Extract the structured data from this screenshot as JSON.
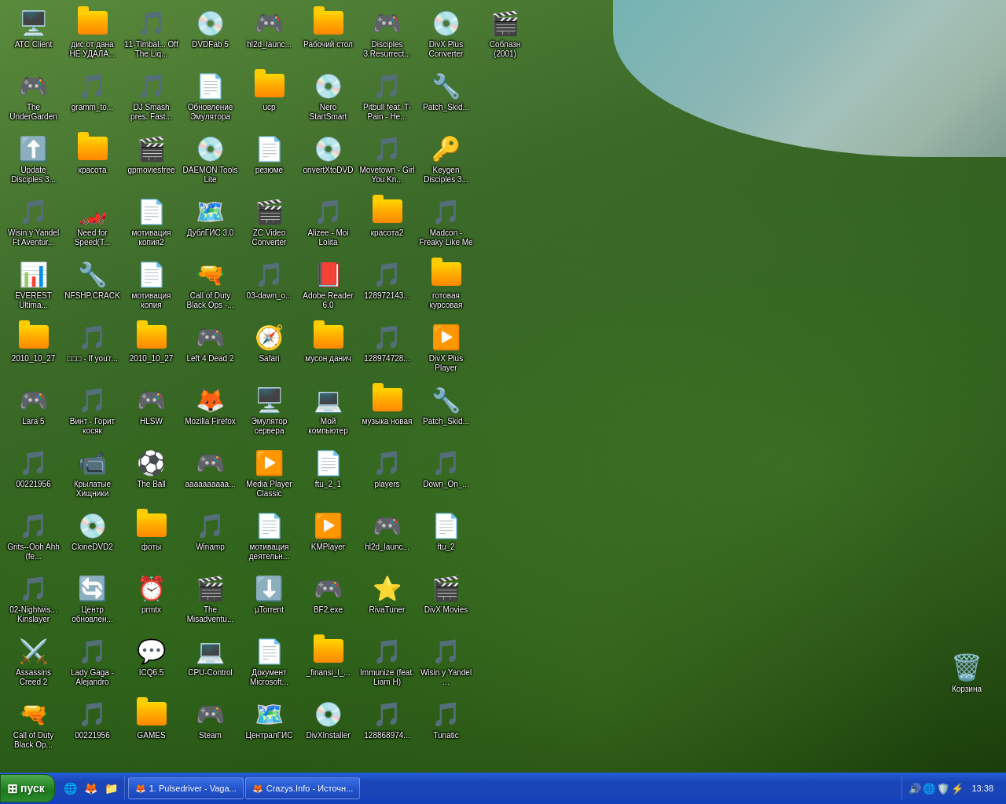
{
  "desktop": {
    "icons": [
      {
        "id": "atc-client",
        "label": "ATC Client",
        "type": "app",
        "emoji": "🖥️",
        "color": "blue"
      },
      {
        "id": "undergarden",
        "label": "The UnderGarden",
        "type": "game",
        "emoji": "🎮",
        "color": "green"
      },
      {
        "id": "update-disciples",
        "label": "Update Disciples 3...",
        "type": "app",
        "emoji": "⬆️",
        "color": "blue"
      },
      {
        "id": "wisin-yandel",
        "label": "Wisin y Yandel Ft Aventur...",
        "type": "media",
        "emoji": "🎵",
        "color": "orange"
      },
      {
        "id": "everest",
        "label": "EVEREST Ultima...",
        "type": "app",
        "emoji": "📊",
        "color": "blue"
      },
      {
        "id": "2010-10-27",
        "label": "2010_10_27",
        "type": "folder",
        "emoji": "📁",
        "color": "yellow"
      },
      {
        "id": "lara5",
        "label": "Lara 5",
        "type": "game",
        "emoji": "🎮",
        "color": "red"
      },
      {
        "id": "00221956-1",
        "label": "00221956",
        "type": "media",
        "emoji": "🎵",
        "color": "orange"
      },
      {
        "id": "grits",
        "label": "Grits--Ooh Ahh (fe...",
        "type": "media",
        "emoji": "🎵",
        "color": "orange"
      },
      {
        "id": "02-nightwis",
        "label": "02-Nightwis... Kinslayer",
        "type": "media",
        "emoji": "🎵",
        "color": "orange"
      },
      {
        "id": "assassins-creed",
        "label": "Assassins Creed 2",
        "type": "game",
        "emoji": "⚔️",
        "color": "white"
      },
      {
        "id": "call-of-duty",
        "label": "Call of Duty Black Op...",
        "type": "game",
        "emoji": "🔫",
        "color": "gray"
      },
      {
        "id": "disc-dana",
        "label": "дис от дана НЕ УДАЛА...",
        "type": "folder",
        "emoji": "📁",
        "color": "yellow"
      },
      {
        "id": "gramm-to",
        "label": "gramm_to...",
        "type": "media",
        "emoji": "🎵",
        "color": "orange"
      },
      {
        "id": "krasota",
        "label": "красота",
        "type": "folder",
        "emoji": "📁",
        "color": "yellow"
      },
      {
        "id": "need-speed",
        "label": "Need for Speed(T...",
        "type": "game",
        "emoji": "🏎️",
        "color": "red"
      },
      {
        "id": "nfshp-crack",
        "label": "NFSHP.CRACK",
        "type": "app",
        "emoji": "🔧",
        "color": "gray"
      },
      {
        "id": "box-ify",
        "label": "□□□ - If you&#39;r...",
        "type": "media",
        "emoji": "🎵",
        "color": "orange"
      },
      {
        "id": "vint",
        "label": "Винт - Горит косяк",
        "type": "media",
        "emoji": "🎵",
        "color": "orange"
      },
      {
        "id": "krylatye",
        "label": "Крылатые Хищники",
        "type": "media",
        "emoji": "📹",
        "color": "blue"
      },
      {
        "id": "clonedvd2",
        "label": "CloneDVD2",
        "type": "app",
        "emoji": "💿",
        "color": "red"
      },
      {
        "id": "centr",
        "label": "Центр обновлен...",
        "type": "app",
        "emoji": "🔄",
        "color": "blue"
      },
      {
        "id": "lady-gaga",
        "label": "Lady Gaga - Alejandro",
        "type": "media",
        "emoji": "🎵",
        "color": "orange"
      },
      {
        "id": "00221956-2",
        "label": "00221956",
        "type": "media",
        "emoji": "🎵",
        "color": "orange"
      },
      {
        "id": "11-timbal",
        "label": "11-Timbal... Off The Liq...",
        "type": "media",
        "emoji": "🎵",
        "color": "orange"
      },
      {
        "id": "dj-smash",
        "label": "DJ Smash pres. Fast...",
        "type": "media",
        "emoji": "🎵",
        "color": "orange"
      },
      {
        "id": "gpmoviesfree",
        "label": "gpmoviesfree",
        "type": "media",
        "emoji": "🎬",
        "color": "blue"
      },
      {
        "id": "motivaciya2",
        "label": "мотивация копия2",
        "type": "doc",
        "emoji": "📄",
        "color": "blue"
      },
      {
        "id": "motivaciya",
        "label": "мотивация копия",
        "type": "doc",
        "emoji": "📄",
        "color": "blue"
      },
      {
        "id": "2010-10-27b",
        "label": "2010_10_27",
        "type": "folder",
        "emoji": "📁",
        "color": "yellow"
      },
      {
        "id": "hlsw",
        "label": "HLSW",
        "type": "app",
        "emoji": "🎮",
        "color": "green"
      },
      {
        "id": "the-ball",
        "label": "The Ball",
        "type": "game",
        "emoji": "⚽",
        "color": "gray"
      },
      {
        "id": "foty",
        "label": "фоты",
        "type": "folder",
        "emoji": "📁",
        "color": "yellow"
      },
      {
        "id": "prmtx",
        "label": "prmtx",
        "type": "app",
        "emoji": "⏰",
        "color": "gray"
      },
      {
        "id": "icq65",
        "label": "ICQ6.5",
        "type": "app",
        "emoji": "💬",
        "color": "green"
      },
      {
        "id": "games",
        "label": "GAMES",
        "type": "folder",
        "emoji": "📁",
        "color": "yellow"
      },
      {
        "id": "dvdfab5",
        "label": "DVDFab 5",
        "type": "app",
        "emoji": "💿",
        "color": "purple"
      },
      {
        "id": "obnovlenie",
        "label": "Обновление Эмулятора",
        "type": "doc",
        "emoji": "📄",
        "color": "blue"
      },
      {
        "id": "daemon-tools",
        "label": "DAEMON Tools Lite",
        "type": "app",
        "emoji": "💿",
        "color": "red"
      },
      {
        "id": "dubgis",
        "label": "ДублГИС 3.0",
        "type": "app",
        "emoji": "🗺️",
        "color": "green"
      },
      {
        "id": "call-duty-ops",
        "label": "Call of Duty Black Ops -...",
        "type": "game",
        "emoji": "🔫",
        "color": "gray"
      },
      {
        "id": "left4dead",
        "label": "Left 4 Dead 2",
        "type": "game",
        "emoji": "🎮",
        "color": "red"
      },
      {
        "id": "firefox",
        "label": "Mozilla Firefox",
        "type": "app",
        "emoji": "🦊",
        "color": "orange"
      },
      {
        "id": "aaaa",
        "label": "аааааааааа...",
        "type": "app",
        "emoji": "🎮",
        "color": "red"
      },
      {
        "id": "winamp",
        "label": "Winamp",
        "type": "app",
        "emoji": "🎵",
        "color": "orange"
      },
      {
        "id": "misadventu",
        "label": "The Misadventu...",
        "type": "media",
        "emoji": "🎬",
        "color": "blue"
      },
      {
        "id": "cpu-control",
        "label": "CPU-Control",
        "type": "app",
        "emoji": "💻",
        "color": "green"
      },
      {
        "id": "steam",
        "label": "Steam",
        "type": "app",
        "emoji": "🎮",
        "color": "blue"
      },
      {
        "id": "hl2d-launc",
        "label": "hl2d_launc...",
        "type": "app",
        "emoji": "🎮",
        "color": "orange"
      },
      {
        "id": "ucp",
        "label": "ucp",
        "type": "folder",
        "emoji": "📁",
        "color": "yellow"
      },
      {
        "id": "rezyume",
        "label": "резюме",
        "type": "doc",
        "emoji": "📄",
        "color": "blue"
      },
      {
        "id": "zc-video",
        "label": "ZC Video Converter",
        "type": "app",
        "emoji": "🎬",
        "color": "blue"
      },
      {
        "id": "03-dawn",
        "label": "03-dawn_o...",
        "type": "media",
        "emoji": "🎵",
        "color": "orange"
      },
      {
        "id": "safari",
        "label": "Safari",
        "type": "app",
        "emoji": "🧭",
        "color": "blue"
      },
      {
        "id": "emulator-serv",
        "label": "Эмулятор сервера",
        "type": "app",
        "emoji": "🖥️",
        "color": "blue"
      },
      {
        "id": "media-player",
        "label": "Media Player Classic",
        "type": "app",
        "emoji": "▶️",
        "color": "gray"
      },
      {
        "id": "motivaciya-deyat",
        "label": "мотивация деятельн...",
        "type": "doc",
        "emoji": "📄",
        "color": "blue"
      },
      {
        "id": "utorrent",
        "label": "µTorrent",
        "type": "app",
        "emoji": "⬇️",
        "color": "green"
      },
      {
        "id": "doc-microsoft",
        "label": "Документ Microsoft...",
        "type": "doc",
        "emoji": "📄",
        "color": "blue"
      },
      {
        "id": "centralgis",
        "label": "ЦентралГИС",
        "type": "app",
        "emoji": "🗺️",
        "color": "green"
      },
      {
        "id": "rabochiy-stol",
        "label": "Рабочий стол",
        "type": "folder",
        "emoji": "📁",
        "color": "yellow"
      },
      {
        "id": "nero",
        "label": "Nero StartSmart",
        "type": "app",
        "emoji": "💿",
        "color": "red"
      },
      {
        "id": "convertdvd",
        "label": "onvertXtoDVD",
        "type": "app",
        "emoji": "💿",
        "color": "red"
      },
      {
        "id": "alizee",
        "label": "Alizee - Moi Lolita",
        "type": "media",
        "emoji": "🎵",
        "color": "orange"
      },
      {
        "id": "adobe-reader",
        "label": "Adobe Reader 6.0",
        "type": "app",
        "emoji": "📕",
        "color": "red"
      },
      {
        "id": "muzon",
        "label": "мусон данич",
        "type": "folder",
        "emoji": "📁",
        "color": "yellow"
      },
      {
        "id": "moy-comp",
        "label": "Мой компьютер",
        "type": "app",
        "emoji": "💻",
        "color": "gray"
      },
      {
        "id": "ftu2-1",
        "label": "ftu_2_1",
        "type": "doc",
        "emoji": "📄",
        "color": "blue"
      },
      {
        "id": "kmplayer",
        "label": "KMPlayer",
        "type": "app",
        "emoji": "▶️",
        "color": "blue"
      },
      {
        "id": "bf2exe",
        "label": "BF2.exe",
        "type": "game",
        "emoji": "🎮",
        "color": "gray"
      },
      {
        "id": "finansi",
        "label": "_finansi_l_...",
        "type": "folder",
        "emoji": "📁",
        "color": "yellow"
      },
      {
        "id": "divxinstaller",
        "label": "DivXInstaller",
        "type": "app",
        "emoji": "💿",
        "color": "blue"
      },
      {
        "id": "disciples3",
        "label": "Disciples 3.Resurrect...",
        "type": "game",
        "emoji": "🎮",
        "color": "red"
      },
      {
        "id": "pitbull",
        "label": "Pitbull feat. T-Pain - He...",
        "type": "media",
        "emoji": "🎵",
        "color": "orange"
      },
      {
        "id": "movetown",
        "label": "Movetown - Girl You Kn...",
        "type": "media",
        "emoji": "🎵",
        "color": "orange"
      },
      {
        "id": "krasota2",
        "label": "красота2",
        "type": "folder",
        "emoji": "📁",
        "color": "yellow"
      },
      {
        "id": "128972143",
        "label": "128972143...",
        "type": "media",
        "emoji": "🎵",
        "color": "orange"
      },
      {
        "id": "128974728",
        "label": "128974728...",
        "type": "media",
        "emoji": "🎵",
        "color": "orange"
      },
      {
        "id": "muzika-nova",
        "label": "музыка новая",
        "type": "folder",
        "emoji": "📁",
        "color": "yellow"
      },
      {
        "id": "players",
        "label": "players",
        "type": "media",
        "emoji": "🎵",
        "color": "orange"
      },
      {
        "id": "hl2d-launc2",
        "label": "hl2d_launc...",
        "type": "app",
        "emoji": "🎮",
        "color": "orange"
      },
      {
        "id": "rivaturner",
        "label": "RivaTuner",
        "type": "app",
        "emoji": "⭐",
        "color": "yellow"
      },
      {
        "id": "immunize",
        "label": "Immunize (feat. Liam H)",
        "type": "media",
        "emoji": "🎵",
        "color": "orange"
      },
      {
        "id": "128868974",
        "label": "128868974...",
        "type": "media",
        "emoji": "🎵",
        "color": "orange"
      },
      {
        "id": "divxplus-conv",
        "label": "DivX Plus Converter",
        "type": "app",
        "emoji": "💿",
        "color": "blue"
      },
      {
        "id": "patch-skid1",
        "label": "Patch_Skid...",
        "type": "app",
        "emoji": "🔧",
        "color": "gray"
      },
      {
        "id": "keygen",
        "label": "Keygen Disciples 3...",
        "type": "app",
        "emoji": "🔑",
        "color": "yellow"
      },
      {
        "id": "madcon",
        "label": "Madcon - Freaky Like Me",
        "type": "media",
        "emoji": "🎵",
        "color": "orange"
      },
      {
        "id": "gotovaya",
        "label": "готовая курсовая",
        "type": "folder",
        "emoji": "📁",
        "color": "yellow"
      },
      {
        "id": "divxplus-play",
        "label": "DivX Plus Player",
        "type": "app",
        "emoji": "▶️",
        "color": "blue"
      },
      {
        "id": "patch-skid2",
        "label": "Patch_Skid...",
        "type": "app",
        "emoji": "🔧",
        "color": "gray"
      },
      {
        "id": "down-on",
        "label": "Down_On_...",
        "type": "media",
        "emoji": "🎵",
        "color": "orange"
      },
      {
        "id": "ftu2",
        "label": "ftu_2",
        "type": "doc",
        "emoji": "📄",
        "color": "blue"
      },
      {
        "id": "divx-movies",
        "label": "DivX Movies",
        "type": "app",
        "emoji": "🎬",
        "color": "blue"
      },
      {
        "id": "wisin-yandel2",
        "label": "Wisin y Yandel ...",
        "type": "media",
        "emoji": "🎵",
        "color": "orange"
      },
      {
        "id": "tunatic",
        "label": "Tunatic",
        "type": "app",
        "emoji": "🎵",
        "color": "purple"
      },
      {
        "id": "soblasnа",
        "label": "Соблазн (2001)",
        "type": "media",
        "emoji": "🎬",
        "color": "blue"
      }
    ],
    "recycle_bin": {
      "label": "Корзина",
      "emoji": "🗑️"
    }
  },
  "taskbar": {
    "start_label": "пуск",
    "quick_icons": [
      "🌐",
      "🦊",
      "📁"
    ],
    "tasks": [
      {
        "id": "task-1",
        "label": "1. Pulsedriver - Vaga...",
        "icon": "🦊",
        "active": false
      },
      {
        "id": "task-2",
        "label": "Crazys.Info - Источн...",
        "icon": "🦊",
        "active": false
      }
    ],
    "systray_icons": [
      "🔊",
      "🌐",
      "🛡️",
      "⚡"
    ],
    "time": "13:38"
  }
}
